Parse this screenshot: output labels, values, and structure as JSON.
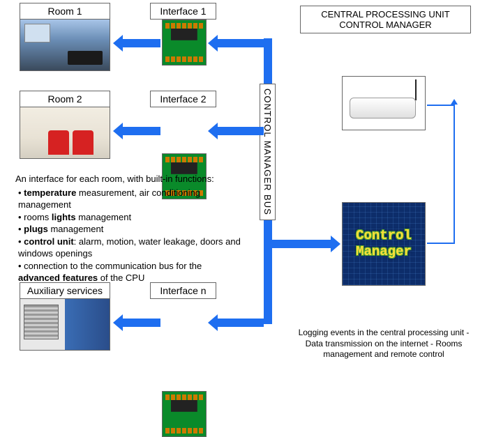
{
  "labels": {
    "room1": "Room 1",
    "room2": "Room 2",
    "aux": "Auxiliary services",
    "if1": "Interface 1",
    "if2": "Interface 2",
    "ifn": "Interface n",
    "bus": "CONTROL MANAGER BUS",
    "cpu_line1": "CENTRAL PROCESSING UNIT",
    "cpu_line2": "CONTROL MANAGER",
    "cm_line1": "Control",
    "cm_line2": "Manager"
  },
  "description": {
    "heading": "An interface for each room, with built-in functions:",
    "items": [
      {
        "pre": "",
        "bold": "temperature",
        "post": " measurement, air conditioning management"
      },
      {
        "pre": "rooms ",
        "bold": "lights",
        "post": " management"
      },
      {
        "pre": "",
        "bold": "plugs",
        "post": " management"
      },
      {
        "pre": "",
        "bold": "control unit",
        "post": ": alarm, motion, water leakage, doors and windows openings"
      },
      {
        "pre": "connection to the communication bus for the ",
        "bold": "advanced features",
        "post": " of the CPU"
      }
    ]
  },
  "footer": "Logging events in the central processing unit - Data transmission on the internet - Rooms management and remote control"
}
